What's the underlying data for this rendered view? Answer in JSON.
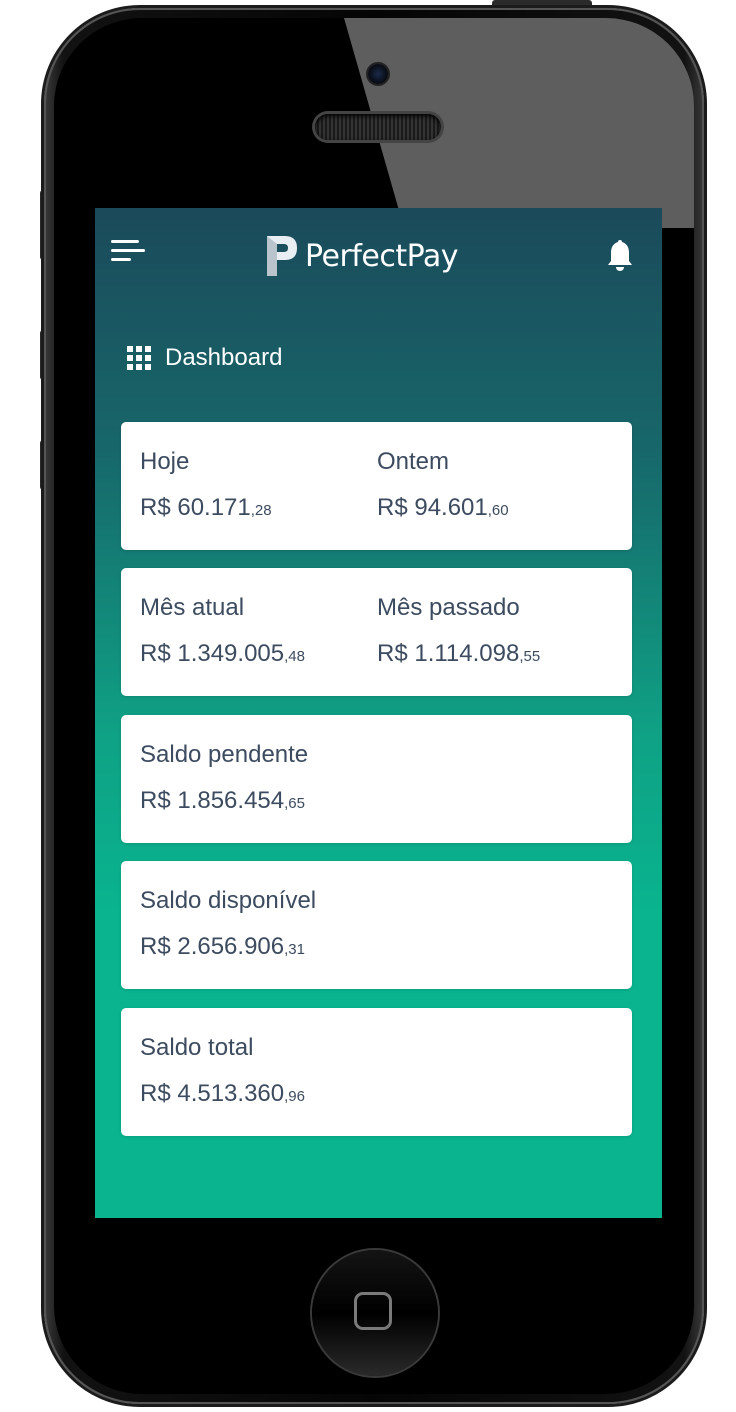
{
  "app": {
    "brand": "PerfectPay",
    "menu_icon": "hamburger-menu-icon",
    "notification_icon": "bell-icon"
  },
  "section": {
    "icon": "grid-icon",
    "title": "Dashboard"
  },
  "cards": {
    "today": {
      "label": "Hoje",
      "amount": "R$ 60.171",
      "cents": ",28"
    },
    "yesterday": {
      "label": "Ontem",
      "amount": "R$ 94.601",
      "cents": ",60"
    },
    "current_month": {
      "label": "Mês atual",
      "amount": "R$ 1.349.005",
      "cents": ",48"
    },
    "last_month": {
      "label": "Mês passado",
      "amount": "R$ 1.114.098",
      "cents": ",55"
    },
    "pending_balance": {
      "label": "Saldo pendente",
      "amount": "R$ 1.856.454",
      "cents": ",65"
    },
    "available_balance": {
      "label": "Saldo disponível",
      "amount": "R$ 2.656.906",
      "cents": ",31"
    },
    "total_balance": {
      "label": "Saldo total",
      "amount": "R$ 4.513.360",
      "cents": ",96"
    }
  },
  "colors": {
    "gradient_top": "#1b4a5a",
    "gradient_bottom": "#09b48f",
    "card_text": "#3c4b5f",
    "card_background": "#ffffff"
  }
}
